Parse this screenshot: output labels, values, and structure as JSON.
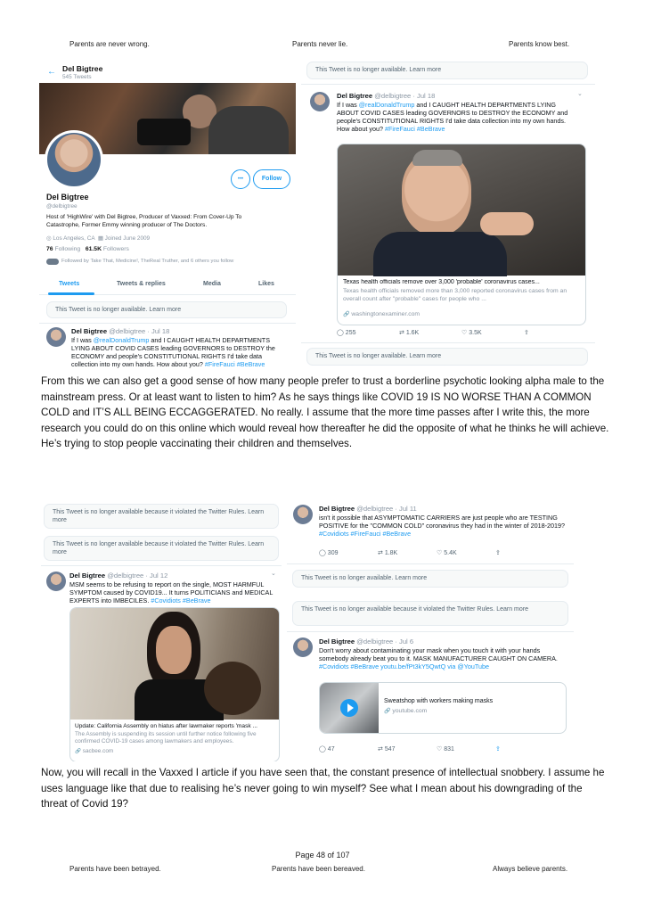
{
  "header": {
    "left": "Parents are never wrong.",
    "center": "Parents never lie.",
    "right": "Parents know best."
  },
  "footer": {
    "page": "Page 48 of 107",
    "left": "Parents have been betrayed.",
    "center": "Parents have been bereaved.",
    "right": "Always believe parents."
  },
  "paragraph1": "From this we can also get a good sense of how many people prefer to trust a borderline psychotic looking alpha male to the mainstream press.  Or at least want to listen to him?  As he says things like COVID 19 IS NO WORSE THAN A COMMON COLD and IT’S ALL BEING ECCAGGERATED.  No really.  I assume that the more time passes after I write this, the more research you could do on this online which would reveal how thereafter he did the opposite of what he thinks he will achieve.  He’s trying to stop people vaccinating their children and themselves.",
  "paragraph2": "Now, you will recall in the Vaxxed I article if you have seen that, the constant presence of intellectual snobbery.  I assume he uses language like that due to realising he’s never going to win myself?  See what I mean about his downgrading of the threat of Covid 19?",
  "profile": {
    "back_arrow": "←",
    "name": "Del Bigtree",
    "tweet_count": "545 Tweets",
    "display_name": "Del Bigtree",
    "handle": "@delbigtree",
    "bio": "Host of 'HighWire' with Del Bigtree, Producer of Vaxxed: From Cover-Up To Catastrophe, Former Emmy winning producer of The Doctors.",
    "location": "Los Angeles, CA",
    "joined": "Joined June 2009",
    "following_count": "76",
    "following_label": "Following",
    "followers_count": "61.5K",
    "followers_label": "Followers",
    "followed_by": "Followed by Take That, Medicine!, TheReal Truther, and 6 others you follow",
    "follow_button": "Follow",
    "more_button": "•••",
    "tabs": [
      "Tweets",
      "Tweets & replies",
      "Media",
      "Likes"
    ],
    "unavailable": "This Tweet is no longer available. Learn more",
    "tweet": {
      "name": "Del Bigtree",
      "meta": "@delbigtree · Jul 18",
      "text_pre": "If I was ",
      "mention": "@realDonaldTrump",
      "text_post": " and I CAUGHT HEALTH DEPARTMENTS LYING ABOUT COVID CASES leading GOVERNORS to DESTROY the ECONOMY and people's CONSTITUTIONAL RIGHTS I'd take data collection into my own hands. How about you? ",
      "hashtags": "#FireFauci #BeBrave"
    }
  },
  "top_right": {
    "unavailable_top": "This Tweet is no longer available. Learn more",
    "unavailable_bottom": "This Tweet is no longer available. Learn more",
    "tweet": {
      "name": "Del Bigtree",
      "meta": "@delbigtree · Jul 18",
      "text_pre": "If I was ",
      "mention": "@realDonaldTrump",
      "text_post": " and I CAUGHT HEALTH DEPARTMENTS LYING ABOUT COVID CASES leading GOVERNORS to DESTROY the ECONOMY and people's CONSTITUTIONAL RIGHTS I'd take data collection into my own hands. How about you? ",
      "hashtags": "#FireFauci #BeBrave",
      "card_title": "Texas health officials remove over 3,000 'probable' coronavirus cases...",
      "card_desc": "Texas health officials removed more than 3,000 reported coronavirus cases from an overall count after \"probable\" cases for people who ...",
      "card_domain": "washingtonexaminer.com",
      "replies": "255",
      "retweets": "1.6K",
      "likes": "3.5K"
    }
  },
  "bottom_left": {
    "violated1": "This Tweet is no longer available because it violated the Twitter Rules. Learn more",
    "violated2": "This Tweet is no longer available because it violated the Twitter Rules. Learn more",
    "tweet": {
      "name": "Del Bigtree",
      "meta": "@delbigtree · Jul 12",
      "text": "MSM seems to be refusing to report on the single, MOST HARMFUL SYMPTOM caused by COVID19... It turns POLITICIANS and MEDICAL EXPERTS into IMBECILES. ",
      "hashtags": "#Covidiots #BeBrave",
      "card_title": "Update: California Assembly on hiatus after lawmaker reports 'mask ...",
      "card_desc": "The Assembly is suspending its session until further notice following five confirmed COVID-19 cases among lawmakers and employees.",
      "card_domain": "sacbee.com"
    }
  },
  "bottom_right": {
    "tweet1": {
      "name": "Del Bigtree",
      "meta": "@delbigtree · Jul 11",
      "text": "isn't it possible that ASYMPTOMATIC CARRIERS are just people who are TESTING POSITIVE for the \"COMMON COLD\" coronavirus they had in the winter of 2018-2019? ",
      "hashtags": "#Covidiots #FireFauci #BeBrave",
      "replies": "309",
      "retweets": "1.8K",
      "likes": "5.4K"
    },
    "unavailable": "This Tweet is no longer available. Learn more",
    "violated": "This Tweet is no longer available because it violated the Twitter Rules. Learn more",
    "tweet2": {
      "name": "Del Bigtree",
      "meta": "@delbigtree · Jul 6",
      "text": "Don't worry about contaminating your mask when you touch it with your hands somebody already beat you to it. MASK MANUFACTURER CAUGHT ON CAMERA. ",
      "links": "#Covidiots #BeBrave youtu.be/fPt3kY5QwtQ via @YouTube",
      "card_title": "Sweatshop with workers making masks",
      "card_domain": "youtube.com",
      "replies": "47",
      "retweets": "547",
      "likes": "831"
    }
  },
  "icons": {
    "reply": "◯",
    "retweet": "⇄",
    "like": "♡",
    "share": "⇪",
    "link": "🔗",
    "location": "◎",
    "calendar": "▦"
  }
}
